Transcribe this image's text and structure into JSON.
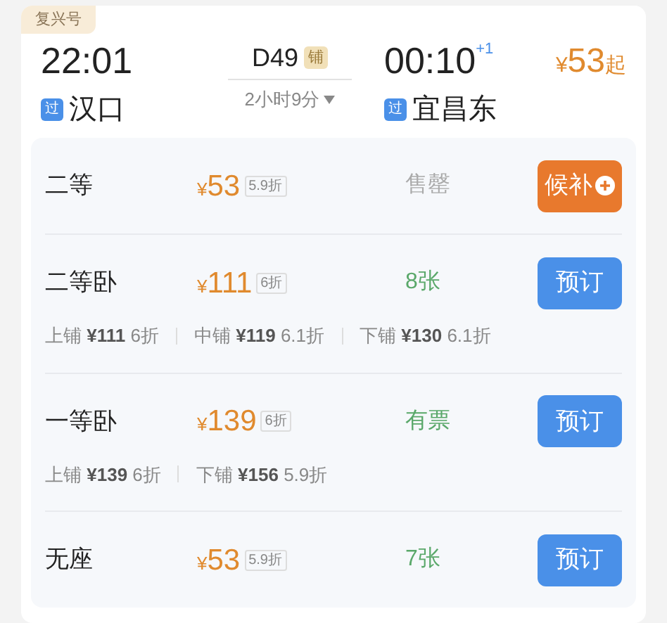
{
  "train_type": "复兴号",
  "departure": {
    "time": "22:01",
    "station_tag": "过",
    "station": "汉口"
  },
  "train": {
    "number": "D49",
    "tag": "铺",
    "duration": "2小时9分"
  },
  "arrival": {
    "time": "00:10",
    "day_offset": "+1",
    "station_tag": "过",
    "station": "宜昌东"
  },
  "lowest_price": {
    "currency": "¥",
    "amount": "53",
    "suffix": "起"
  },
  "seats": [
    {
      "name": "二等",
      "currency": "¥",
      "amount": "53",
      "discount": "5.9折",
      "status": "售罄",
      "available": false,
      "button": {
        "kind": "waitlist",
        "label": "候补"
      }
    },
    {
      "name": "二等卧",
      "currency": "¥",
      "amount": "111",
      "discount": "6折",
      "status": "8张",
      "available": true,
      "button": {
        "kind": "book",
        "label": "预订"
      },
      "berths": [
        {
          "label": "上铺",
          "price": "¥111",
          "discount": "6折"
        },
        {
          "label": "中铺",
          "price": "¥119",
          "discount": "6.1折"
        },
        {
          "label": "下铺",
          "price": "¥130",
          "discount": "6.1折"
        }
      ]
    },
    {
      "name": "一等卧",
      "currency": "¥",
      "amount": "139",
      "discount": "6折",
      "status": "有票",
      "available": true,
      "button": {
        "kind": "book",
        "label": "预订"
      },
      "berths": [
        {
          "label": "上铺",
          "price": "¥139",
          "discount": "6折"
        },
        {
          "label": "下铺",
          "price": "¥156",
          "discount": "5.9折"
        }
      ]
    },
    {
      "name": "无座",
      "currency": "¥",
      "amount": "53",
      "discount": "5.9折",
      "status": "7张",
      "available": true,
      "button": {
        "kind": "book",
        "label": "预订"
      }
    }
  ]
}
